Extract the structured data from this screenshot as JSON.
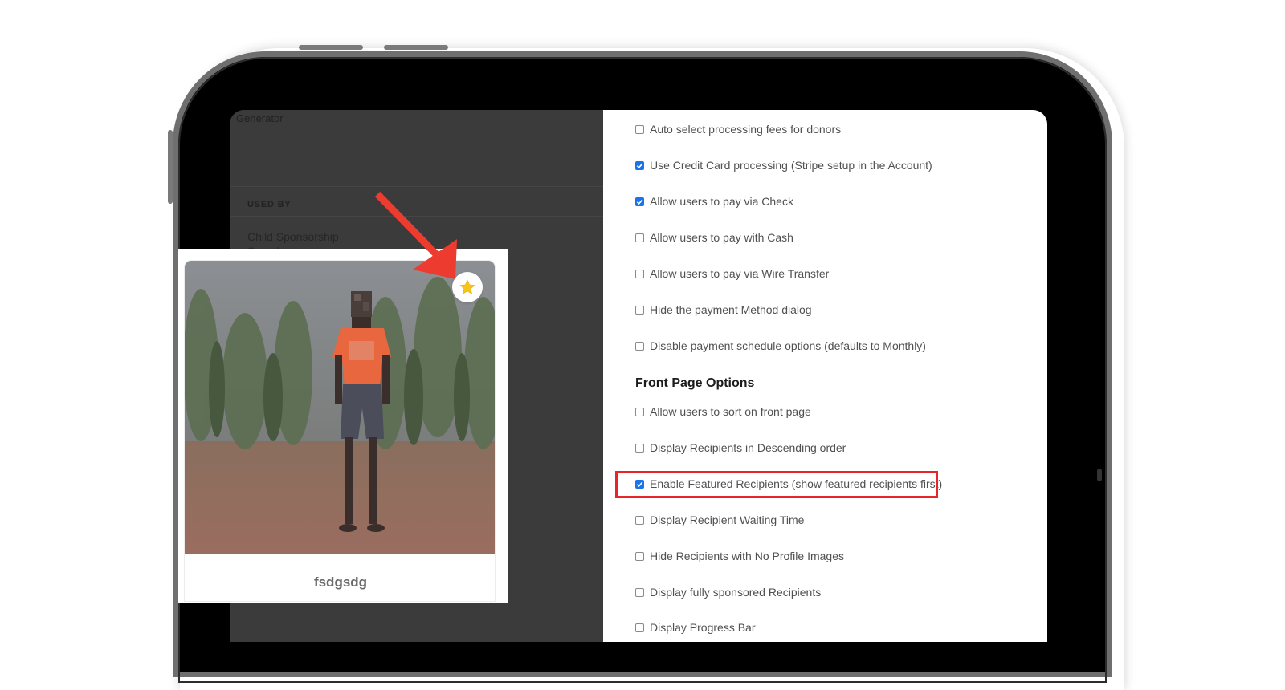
{
  "left_panel": {
    "title": "Generator",
    "used_by_label": "USED BY",
    "used_by_item": "Child Sponsorship Sample"
  },
  "payment_options": [
    {
      "label": "Auto select processing fees for donors",
      "checked": false
    },
    {
      "label": "Use Credit Card processing (Stripe setup in the Account)",
      "checked": true
    },
    {
      "label": "Allow users to pay via Check",
      "checked": true
    },
    {
      "label": "Allow users to pay with Cash",
      "checked": false
    },
    {
      "label": "Allow users to pay via Wire Transfer",
      "checked": false
    },
    {
      "label": "Hide the payment Method dialog",
      "checked": false
    },
    {
      "label": "Disable payment schedule options (defaults to Monthly)",
      "checked": false
    }
  ],
  "front_page": {
    "title": "Front Page Options",
    "options": [
      {
        "label": "Allow users to sort on front page",
        "checked": false
      },
      {
        "label": "Display Recipients in Descending order",
        "checked": false
      },
      {
        "label": "Enable Featured Recipients (show featured recipients first)",
        "checked": true,
        "highlighted": true
      },
      {
        "label": "Display Recipient Waiting Time",
        "checked": false
      },
      {
        "label": "Hide Recipients with No Profile Images",
        "checked": false
      },
      {
        "label": "Display fully sponsored Recipients",
        "checked": false
      },
      {
        "label": "Display Progress Bar",
        "checked": false
      }
    ]
  },
  "recipient_card": {
    "name": "fsdgsdg",
    "featured": true,
    "icon": "star-icon"
  },
  "colors": {
    "checkbox_on": "#1a73e8",
    "highlight": "#e8262a",
    "arrow": "#ee3b2f",
    "star": "#f5c518"
  }
}
